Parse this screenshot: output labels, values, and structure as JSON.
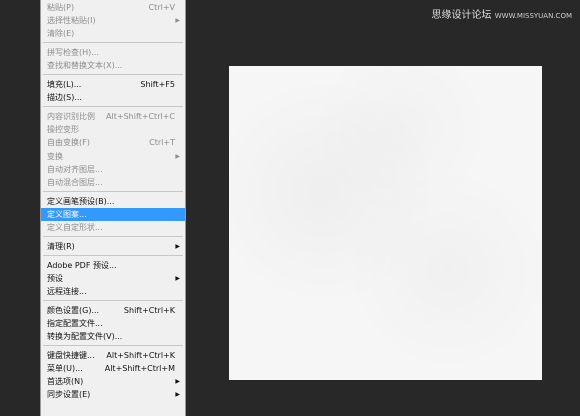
{
  "menu": {
    "items": [
      {
        "label": "粘贴(P)",
        "shortcut": "Ctrl+V",
        "disabled": true
      },
      {
        "label": "选择性粘贴(I)",
        "arrow": "▶",
        "disabled": true
      },
      {
        "label": "清除(E)",
        "disabled": true
      },
      {
        "label": "拼写检查(H)...",
        "disabled": true
      },
      {
        "label": "查找和替换文本(X)...",
        "disabled": true
      },
      {
        "label": "填充(L)...",
        "shortcut": "Shift+F5"
      },
      {
        "label": "描边(S)..."
      },
      {
        "label": "内容识别比例",
        "shortcut": "Alt+Shift+Ctrl+C",
        "disabled": true
      },
      {
        "label": "操控变形",
        "disabled": true
      },
      {
        "label": "自由变换(F)",
        "shortcut": "Ctrl+T",
        "disabled": true
      },
      {
        "label": "变换",
        "arrow": "▶",
        "disabled": true
      },
      {
        "label": "自动对齐图层...",
        "disabled": true
      },
      {
        "label": "自动混合图层...",
        "disabled": true
      },
      {
        "label": "定义画笔预设(B)..."
      },
      {
        "label": "定义图案...",
        "highlighted": true
      },
      {
        "label": "定义自定形状...",
        "disabled": true
      },
      {
        "label": "清理(R)",
        "arrow": "▶"
      },
      {
        "label": "Adobe PDF 预设..."
      },
      {
        "label": "预设",
        "arrow": "▶"
      },
      {
        "label": "远程连接..."
      },
      {
        "label": "颜色设置(G)...",
        "shortcut": "Shift+Ctrl+K"
      },
      {
        "label": "指定配置文件..."
      },
      {
        "label": "转换为配置文件(V)..."
      },
      {
        "label": "键盘快捷键...",
        "shortcut": "Alt+Shift+Ctrl+K"
      },
      {
        "label": "菜单(U)...",
        "shortcut": "Alt+Shift+Ctrl+M"
      },
      {
        "label": "首选项(N)",
        "arrow": "▶"
      },
      {
        "label": "同步设置(E)",
        "arrow": "▶"
      }
    ]
  },
  "watermark": {
    "text": "思缘设计论坛",
    "url": "WWW.MISSYUAN.COM"
  }
}
